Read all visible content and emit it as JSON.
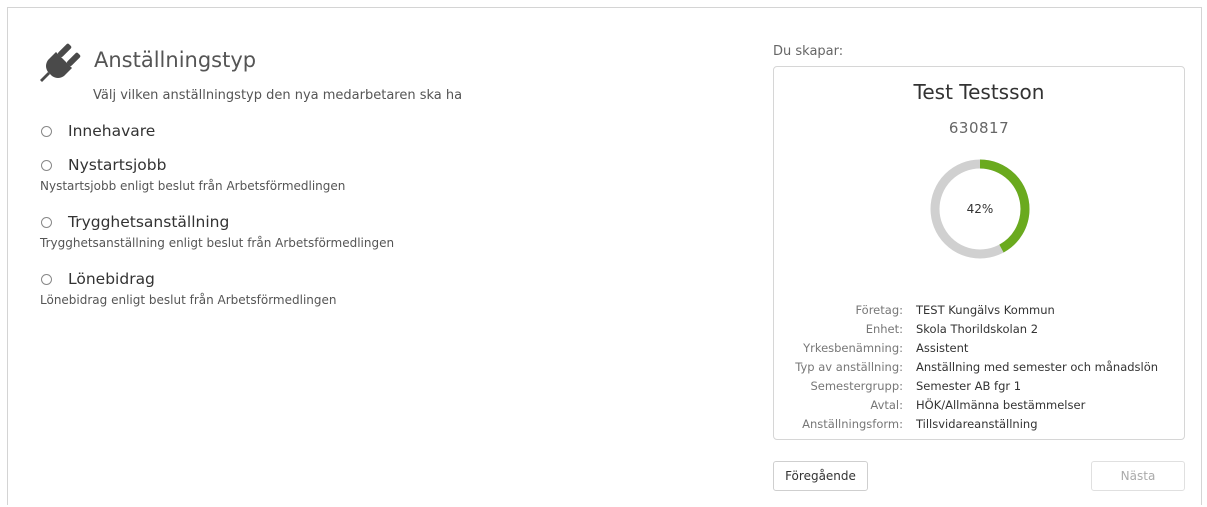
{
  "header": {
    "icon": "plug-icon",
    "title": "Anställningstyp",
    "subtitle": "Välj vilken anställningstyp den nya medarbetaren ska ha"
  },
  "options": [
    {
      "label": "Innehavare",
      "description": "",
      "selected": false
    },
    {
      "label": "Nystartsjobb",
      "description": "Nystartsjobb enligt beslut från Arbetsförmedlingen",
      "selected": false
    },
    {
      "label": "Trygghetsanställning",
      "description": "Trygghetsanställning enligt beslut från Arbetsförmedlingen",
      "selected": false
    },
    {
      "label": "Lönebidrag",
      "description": "Lönebidrag enligt beslut från Arbetsförmedlingen",
      "selected": false
    }
  ],
  "summary": {
    "heading": "Du skapar:",
    "name": "Test Testsson",
    "id": "630817",
    "progress": {
      "percent": 42,
      "label": "42%",
      "color": "#6aaa1e",
      "track_color": "#d0d0d0"
    },
    "details": [
      {
        "key": "Företag:",
        "value": "TEST Kungälvs Kommun"
      },
      {
        "key": "Enhet:",
        "value": "Skola Thorildskolan 2"
      },
      {
        "key": "Yrkesbenämning:",
        "value": "Assistent"
      },
      {
        "key": "Typ av anställning:",
        "value": "Anställning med semester och månadslön"
      },
      {
        "key": "Semestergrupp:",
        "value": "Semester AB fgr 1"
      },
      {
        "key": "Avtal:",
        "value": "HÖK/Allmänna bestämmelser"
      },
      {
        "key": "Anställningsform:",
        "value": "Tillsvidareanställning"
      }
    ]
  },
  "buttons": {
    "previous": "Föregående",
    "next": "Nästa",
    "next_enabled": false
  }
}
